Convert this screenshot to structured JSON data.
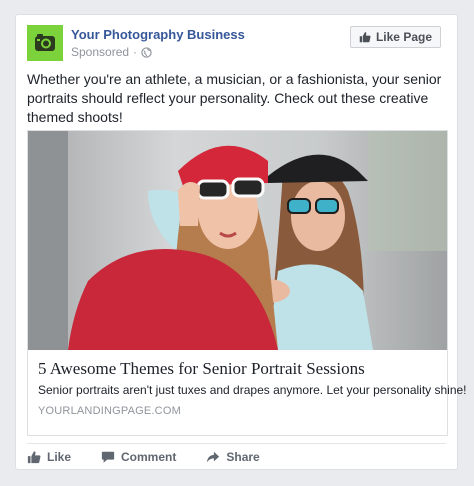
{
  "post": {
    "page_name": "Your Photography Business",
    "sponsored_label": "Sponsored",
    "sponsored_separator": "·",
    "like_page_label": "Like Page",
    "text": "Whether you're an athlete, a musician, or a fashionista, your senior portraits should reflect your personality. Check out these creative themed shoots!"
  },
  "link": {
    "title": "5 Awesome Themes for Senior Portrait Sessions",
    "description": "Senior portraits aren't just tuxes and drapes anymore. Let your personality shine!",
    "domain": "YOURLANDINGPAGE.COM"
  },
  "actions": {
    "like_label": "Like",
    "comment_label": "Comment",
    "share_label": "Share"
  },
  "icons": {
    "avatar": "camera-icon",
    "privacy": "globe-icon",
    "like_page": "thumbs-up-icon",
    "like": "thumbs-up-icon",
    "comment": "speech-bubble-icon",
    "share": "share-arrow-icon"
  },
  "colors": {
    "brand_green": "#7bd23a",
    "link_blue": "#365899",
    "page_bg": "#e9ebee"
  }
}
